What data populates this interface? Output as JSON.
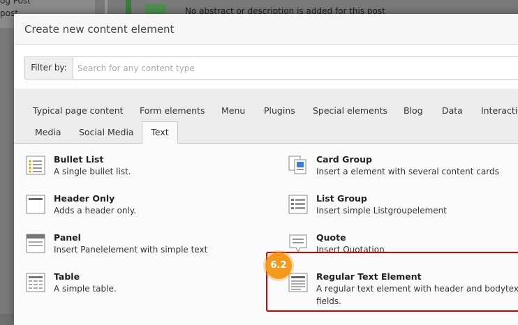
{
  "background": {
    "left_lines": [
      "og Post",
      "post"
    ],
    "notice": "No abstract or description is added for this post"
  },
  "modal": {
    "title": "Create new content element",
    "filter": {
      "label": "Filter by:",
      "placeholder": "Search for any content type"
    },
    "tabs_row1": [
      "Typical page content",
      "Form elements",
      "Menu",
      "Plugins",
      "Special elements",
      "Blog",
      "Data",
      "Interacti"
    ],
    "tabs_row2": [
      "Media",
      "Social Media",
      "Text"
    ],
    "active_tab": "Text",
    "items": [
      {
        "title": "Bullet List",
        "desc": "A single bullet list.",
        "icon": "bullet-list-icon"
      },
      {
        "title": "Card Group",
        "desc": "Insert a element with several content cards",
        "icon": "card-group-icon"
      },
      {
        "title": "Header Only",
        "desc": "Adds a header only.",
        "icon": "header-only-icon"
      },
      {
        "title": "List Group",
        "desc": "Insert simple Listgroupelement",
        "icon": "list-group-icon"
      },
      {
        "title": "Panel",
        "desc": "Insert Panelelement with simple text",
        "icon": "panel-icon"
      },
      {
        "title": "Quote",
        "desc": "Insert Quotation",
        "icon": "quote-icon"
      },
      {
        "title": "Table",
        "desc": "A simple table.",
        "icon": "table-icon"
      },
      {
        "title": "Regular Text Element",
        "desc": "A regular text element with header and bodytex",
        "desc2": "fields.",
        "icon": "regular-text-icon"
      }
    ]
  },
  "annotation": {
    "badge": "6.2"
  },
  "colors": {
    "highlight": "#d10000",
    "badge": "#f39a1e"
  }
}
